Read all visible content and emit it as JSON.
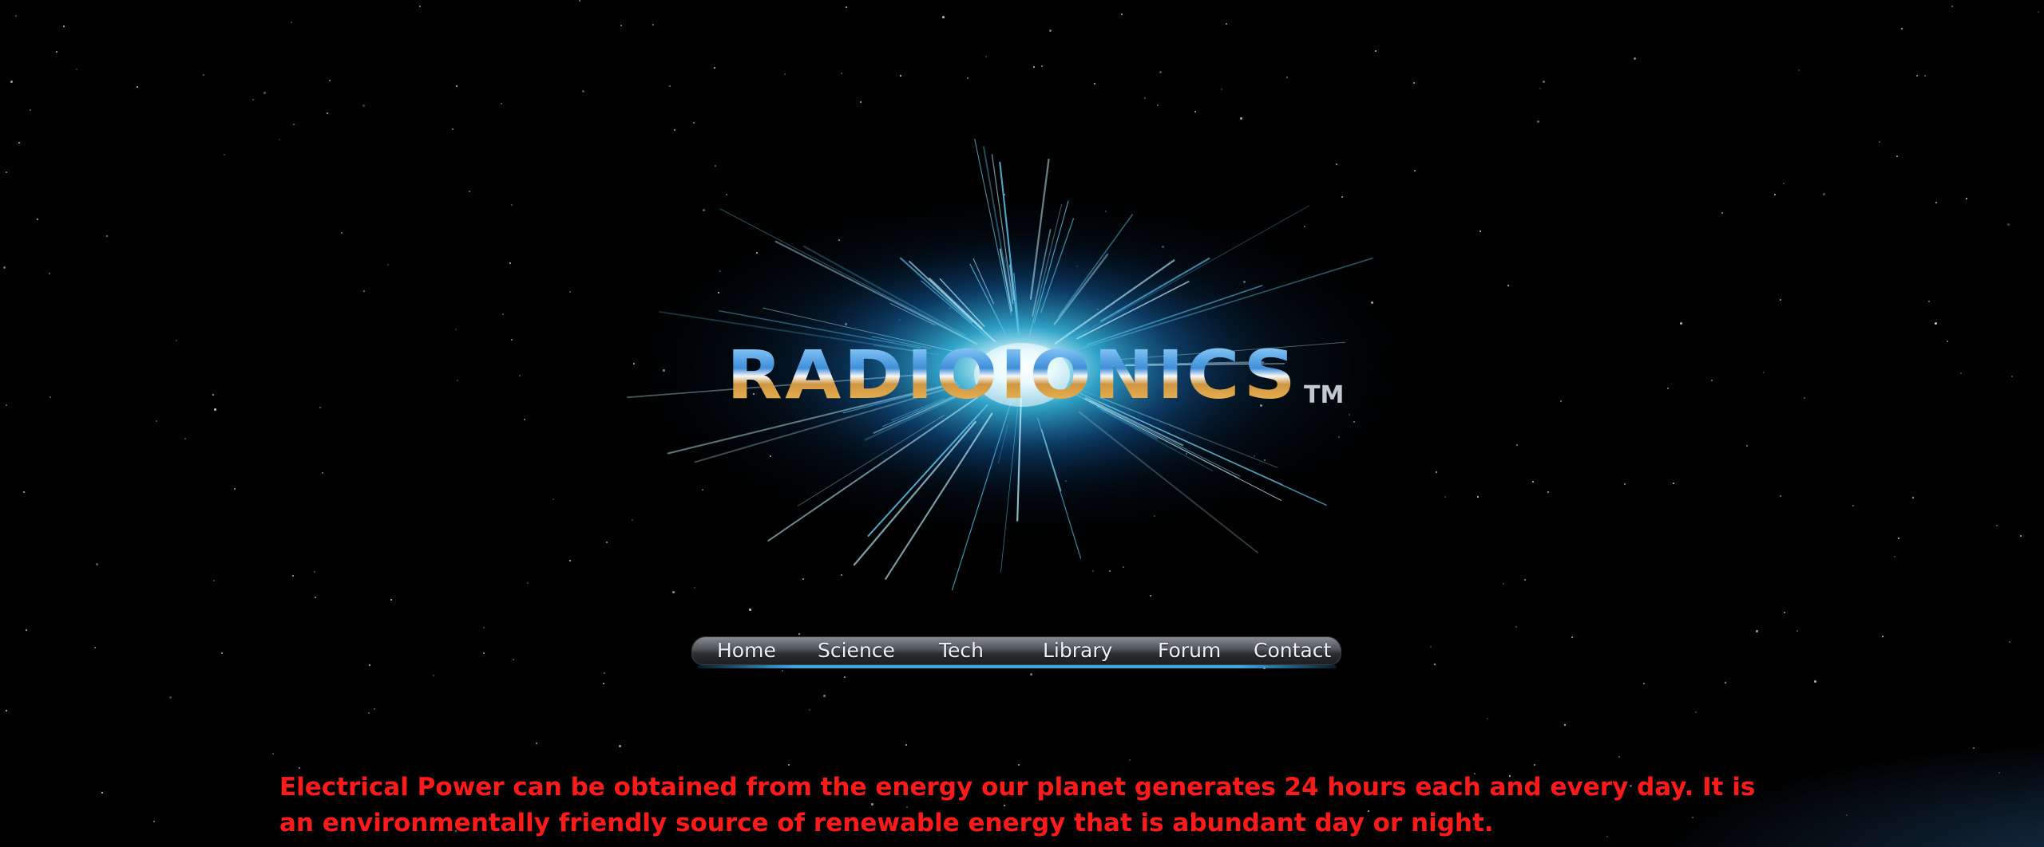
{
  "colors": {
    "background": "#000000",
    "tagline": "#ff1a1a",
    "nav_text": "#eef2f6",
    "nav_accent_line": "#3aa7e0",
    "logo_blue": "#3e8fd9",
    "logo_gold": "#f5bd55"
  },
  "logo": {
    "wordmark": "RADIOIONICS",
    "trademark": "TM",
    "icon": "energy-burst-icon"
  },
  "nav": {
    "items": [
      {
        "label": "Home"
      },
      {
        "label": "Science"
      },
      {
        "label": "Tech"
      },
      {
        "label": "Library"
      },
      {
        "label": "Forum"
      },
      {
        "label": "Contact"
      }
    ]
  },
  "content": {
    "tagline": "Electrical Power can be obtained from the energy our planet generates 24 hours each and every day. It is an environmentally friendly source of renewable energy that is abundant day or night."
  }
}
